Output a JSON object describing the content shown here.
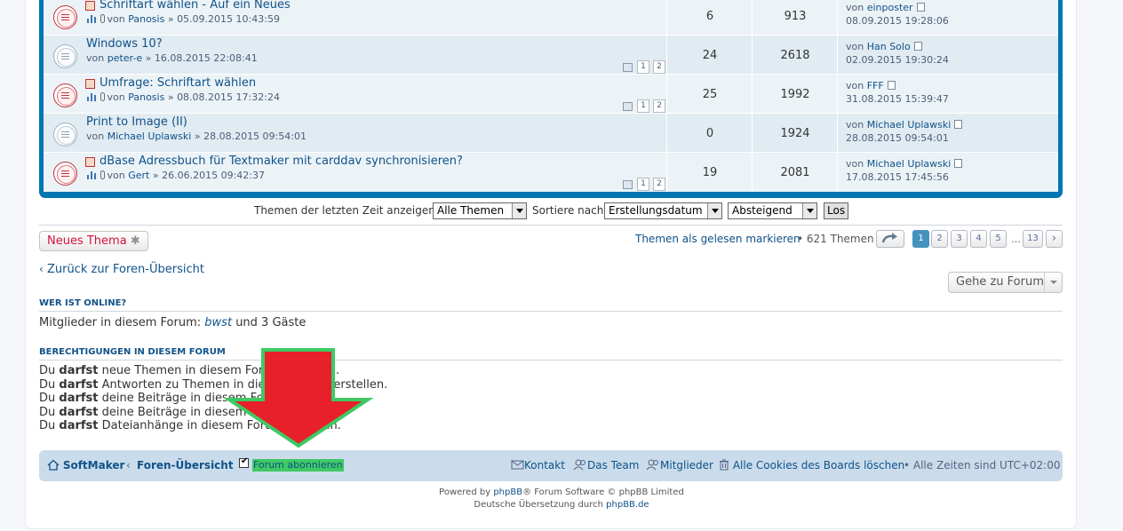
{
  "topics": [
    {
      "title": "Schriftart wählen - Auf ein Neues",
      "author": "Panosis",
      "date": "05.09.2015 10:43:59",
      "replies": "6",
      "views": "913",
      "last_author": "einposter",
      "last_date": "08.09.2015 19:28:06",
      "hot": true,
      "pages": []
    },
    {
      "title": "Windows 10?",
      "author": "peter-e",
      "date": "16.08.2015 22:08:41",
      "replies": "24",
      "views": "2618",
      "last_author": "Han Solo",
      "last_date": "02.09.2015 19:30:24",
      "hot": false,
      "pages": [
        "1",
        "2"
      ]
    },
    {
      "title": "Umfrage: Schriftart wählen",
      "author": "Panosis",
      "date": "08.08.2015 17:32:24",
      "replies": "25",
      "views": "1992",
      "last_author": "FFF",
      "last_date": "31.08.2015 15:39:47",
      "hot": true,
      "pages": [
        "1",
        "2"
      ]
    },
    {
      "title": "Print to Image (II)",
      "author": "Michael Uplawski",
      "date": "28.08.2015 09:54:01",
      "replies": "0",
      "views": "1924",
      "last_author": "Michael Uplawski",
      "last_date": "28.08.2015 09:54:01",
      "hot": false,
      "pages": []
    },
    {
      "title": "dBase Adressbuch für Textmaker mit carddav synchronisieren?",
      "author": "Gert",
      "date": "26.06.2015 09:42:37",
      "replies": "19",
      "views": "2081",
      "last_author": "Michael Uplawski",
      "last_date": "17.08.2015 17:45:56",
      "hot": true,
      "pages": [
        "1",
        "2"
      ]
    }
  ],
  "labels": {
    "by": "von",
    "sep": "»"
  },
  "sortbar": {
    "show_label": "Themen der letzten Zeit anzeigen:",
    "show_value": "Alle Themen",
    "sort_label": "Sortiere nach",
    "sort_value": "Erstellungsdatum",
    "order_value": "Absteigend",
    "go": "Los"
  },
  "actions": {
    "new_topic": "Neues Thema",
    "mark_read": "Themen als gelesen markieren",
    "topic_count": "• 621 Themen",
    "pages": [
      "1",
      "2",
      "3",
      "4",
      "5"
    ],
    "ellipsis": "…",
    "last_page": "13",
    "back": "Zurück zur Foren-Übersicht",
    "jump": "Gehe zu Forum"
  },
  "online": {
    "heading": "WER IST ONLINE?",
    "prefix": "Mitglieder in diesem Forum:",
    "user": "bwst",
    "suffix": "und 3 Gäste"
  },
  "perms": {
    "heading": "BERECHTIGUNGEN IN DIESEM FORUM",
    "you": "Du",
    "can": "darfst",
    "lines": [
      "neue Themen in diesem Forum erstellen.",
      "Antworten zu Themen in diesem Forum erstellen.",
      "deine Beiträge in diesem Forum ändern.",
      "deine Beiträge in diesem Forum löschen.",
      "Dateianhänge in diesem Forum erstellen."
    ]
  },
  "navbar": {
    "home": "SoftMaker",
    "index": "Foren-Übersicht",
    "subscribe": "Forum abonnieren",
    "contact": "Kontakt",
    "team": "Das Team",
    "members": "Mitglieder",
    "cookies": "Alle Cookies des Boards löschen",
    "tz": "• Alle Zeiten sind UTC+02:00"
  },
  "footer": {
    "line1_a": "Powered by",
    "line1_link": "phpBB",
    "line1_b": "® Forum Software © phpBB Limited",
    "line2_a": "Deutsche Übersetzung durch",
    "line2_link": "phpBB.de"
  },
  "colors": {
    "topic_border": "#0076b3",
    "highlight": "#3ec964",
    "arrow": "#e8202a",
    "navbar": "#cadceb"
  }
}
